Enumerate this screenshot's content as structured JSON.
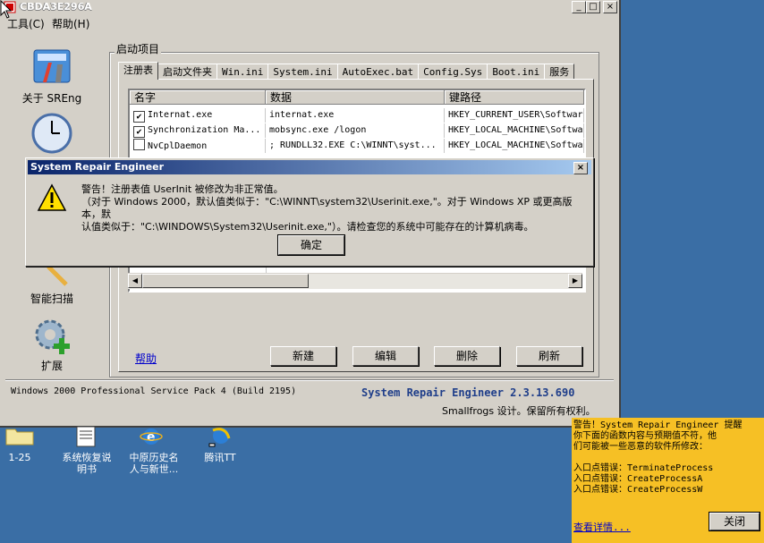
{
  "window": {
    "title": "CBDA3E296A",
    "menu": [
      "工具(C)",
      "帮助(H)"
    ],
    "min": "_",
    "max": "□",
    "close": "×"
  },
  "sidebar": {
    "items": [
      {
        "label": "关于 SREng"
      },
      {
        "label": ""
      },
      {
        "label": "智能扫描"
      },
      {
        "label": "扩展"
      }
    ]
  },
  "group_label": "启动项目",
  "tabs": [
    "注册表",
    "启动文件夹",
    "Win.ini",
    "System.ini",
    "AutoExec.bat",
    "Config.Sys",
    "Boot.ini",
    "服务"
  ],
  "table": {
    "columns": [
      "名字",
      "数据",
      "键路径"
    ],
    "rows": [
      {
        "checked": true,
        "name": "Internat.exe",
        "data": "internat.exe",
        "path": "HKEY_CURRENT_USER\\Softwar"
      },
      {
        "checked": true,
        "name": "Synchronization Ma...",
        "data": "mobsync.exe /logon",
        "path": "HKEY_LOCAL_MACHINE\\Softwa"
      },
      {
        "checked": false,
        "name": "NvCplDaemon",
        "data": "; RUNDLL32.EXE C:\\WINNT\\syst...",
        "path": "HKEY_LOCAL_MACHINE\\Softwa"
      }
    ]
  },
  "buttons": {
    "help": "帮助",
    "new": "新建",
    "edit": "编辑",
    "delete": "删除",
    "refresh": "刷新"
  },
  "status": {
    "os": "Windows 2000 Professional Service Pack 4 (Build 2195)",
    "product": "System Repair Engineer 2.3.13.690",
    "copyright": "Smallfrogs 设计。保留所有权利。"
  },
  "dialog": {
    "title": "System Repair Engineer",
    "close": "×",
    "message_line1": "警告！注册表值 UserInit 被修改为非正常值。",
    "message_line2": "（对于 Windows 2000，默认值类似于：\"C:\\WINNT\\system32\\Userinit.exe,\"。对于 Windows XP 或更高版本，默",
    "message_line3": "认值类似于：\"C:\\WINDOWS\\System32\\Userinit.exe,\"）。请检查您的系统中可能存在的计算机病毒。",
    "ok": "确定"
  },
  "desktop": {
    "icons": [
      {
        "label1": "1-25",
        "label2": ""
      },
      {
        "label1": "系统恢复说",
        "label2": "明书"
      },
      {
        "label1": "中原历史名",
        "label2": "人与新世..."
      },
      {
        "label1": "腾讯TT",
        "label2": ""
      }
    ]
  },
  "notification": {
    "line1": "警告！System Repair Engineer 提醒",
    "line2": "你下面的函数内容与预期值不符，他",
    "line3": "们可能被一些恶意的软件所修改：",
    "line4": "入口点错误：TerminateProcess",
    "line5": "入口点错误：CreateProcessA",
    "line6": "入口点错误：CreateProcessW",
    "details": "查看详情...",
    "close": "关闭"
  }
}
